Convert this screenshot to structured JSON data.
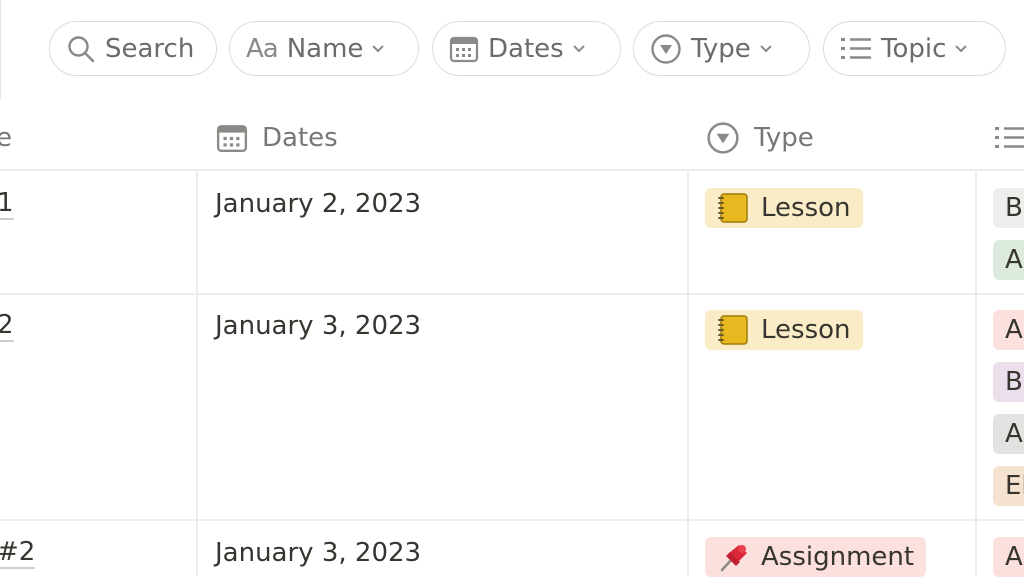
{
  "filters": {
    "search": "Search",
    "name": "Name",
    "dates": "Dates",
    "type": "Type",
    "topic": "Topic"
  },
  "columns": {
    "name_fragment": "e",
    "dates": "Dates",
    "type": "Type"
  },
  "rows": [
    {
      "name_fragment": "1",
      "date": "January 2, 2023",
      "type": "Lesson",
      "topics": [
        "B",
        "A"
      ]
    },
    {
      "name_fragment": "2",
      "date": "January 3, 2023",
      "type": "Lesson",
      "topics": [
        "A",
        "B",
        "A",
        "El"
      ]
    },
    {
      "name_fragment": "#2",
      "date": "January 3, 2023",
      "type": "Assignment",
      "topics": [
        "A"
      ]
    }
  ],
  "colors": {
    "lesson_tag": "#fbecc8",
    "assignment_tag": "#fbe0dd",
    "topic_gray": "#ededeb",
    "topic_green": "#dcebdd",
    "topic_red": "#fbe0dd",
    "topic_purple": "#ecdfec",
    "topic_darkgray": "#e3e2e0",
    "topic_orange": "#f6e2d0"
  },
  "icons": {
    "search": "search-icon",
    "name": "text-aa-icon",
    "dates": "calendar-icon",
    "type": "select-circle-icon",
    "topic": "list-icon",
    "lesson": "notebook-emoji",
    "assignment": "pushpin-emoji"
  }
}
